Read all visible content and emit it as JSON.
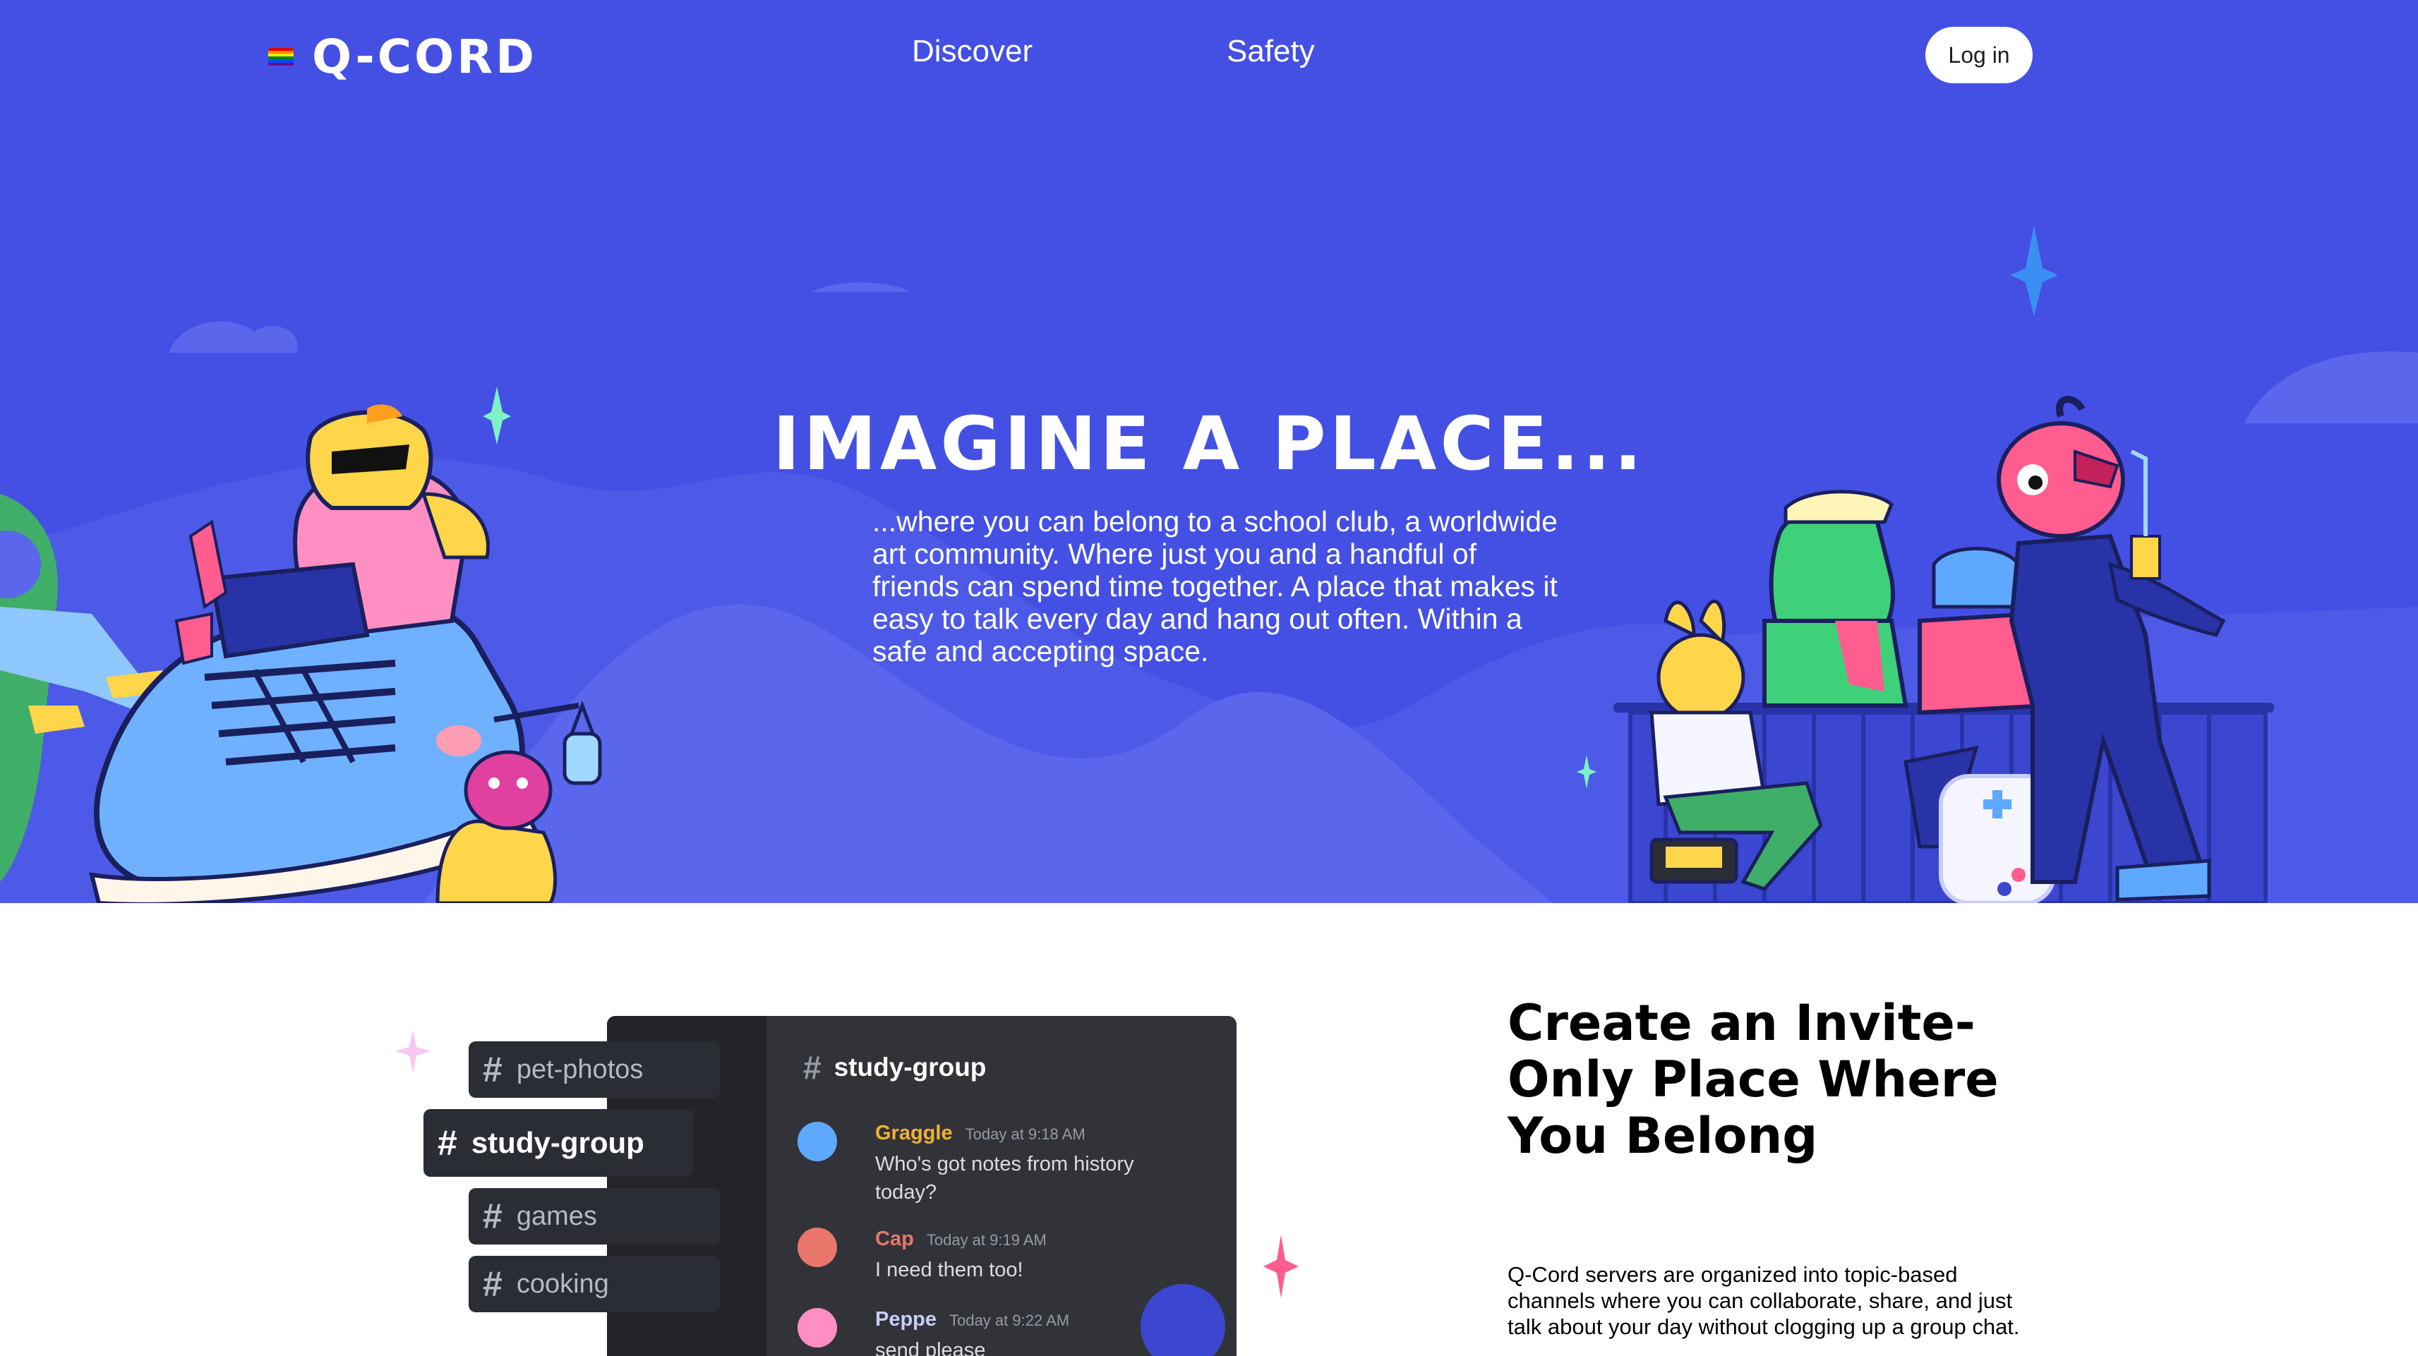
{
  "nav": {
    "brand": "Q-CORD",
    "links": [
      "Discover",
      "Safety"
    ],
    "login_label": "Log in"
  },
  "hero": {
    "title": "IMAGINE A PLACE...",
    "description": "...where you can belong to a school club, a worldwide art community. Where just you and a handful of friends can spend time together. A place that makes it easy to talk every day and hang out often. Within a safe and accepting space."
  },
  "feature": {
    "channels": [
      "pet-photos",
      "study-group",
      "games",
      "cooking"
    ],
    "active_channel": "study-group",
    "chat": {
      "channel_name": "study-group",
      "messages": [
        {
          "author": "Graggle",
          "time": "Today at 9:18 AM",
          "text": "Who's got notes from history today?",
          "color": "#f0b232"
        },
        {
          "author": "Cap",
          "time": "Today at 9:19 AM",
          "text": "I need them too!",
          "color": "#e8766b"
        },
        {
          "author": "Peppe",
          "time": "Today at 9:22 AM",
          "text": "send please",
          "color": "#c9cdfb"
        }
      ]
    },
    "title": "Create an Invite-Only Place Where You Belong",
    "description": "Q-Cord servers are organized into topic-based channels where you can collaborate, share, and just talk about your day without clogging up a group chat."
  },
  "colors": {
    "hero_bg": "#4450e4",
    "white": "#ffffff",
    "dark_panel": "#313338"
  }
}
